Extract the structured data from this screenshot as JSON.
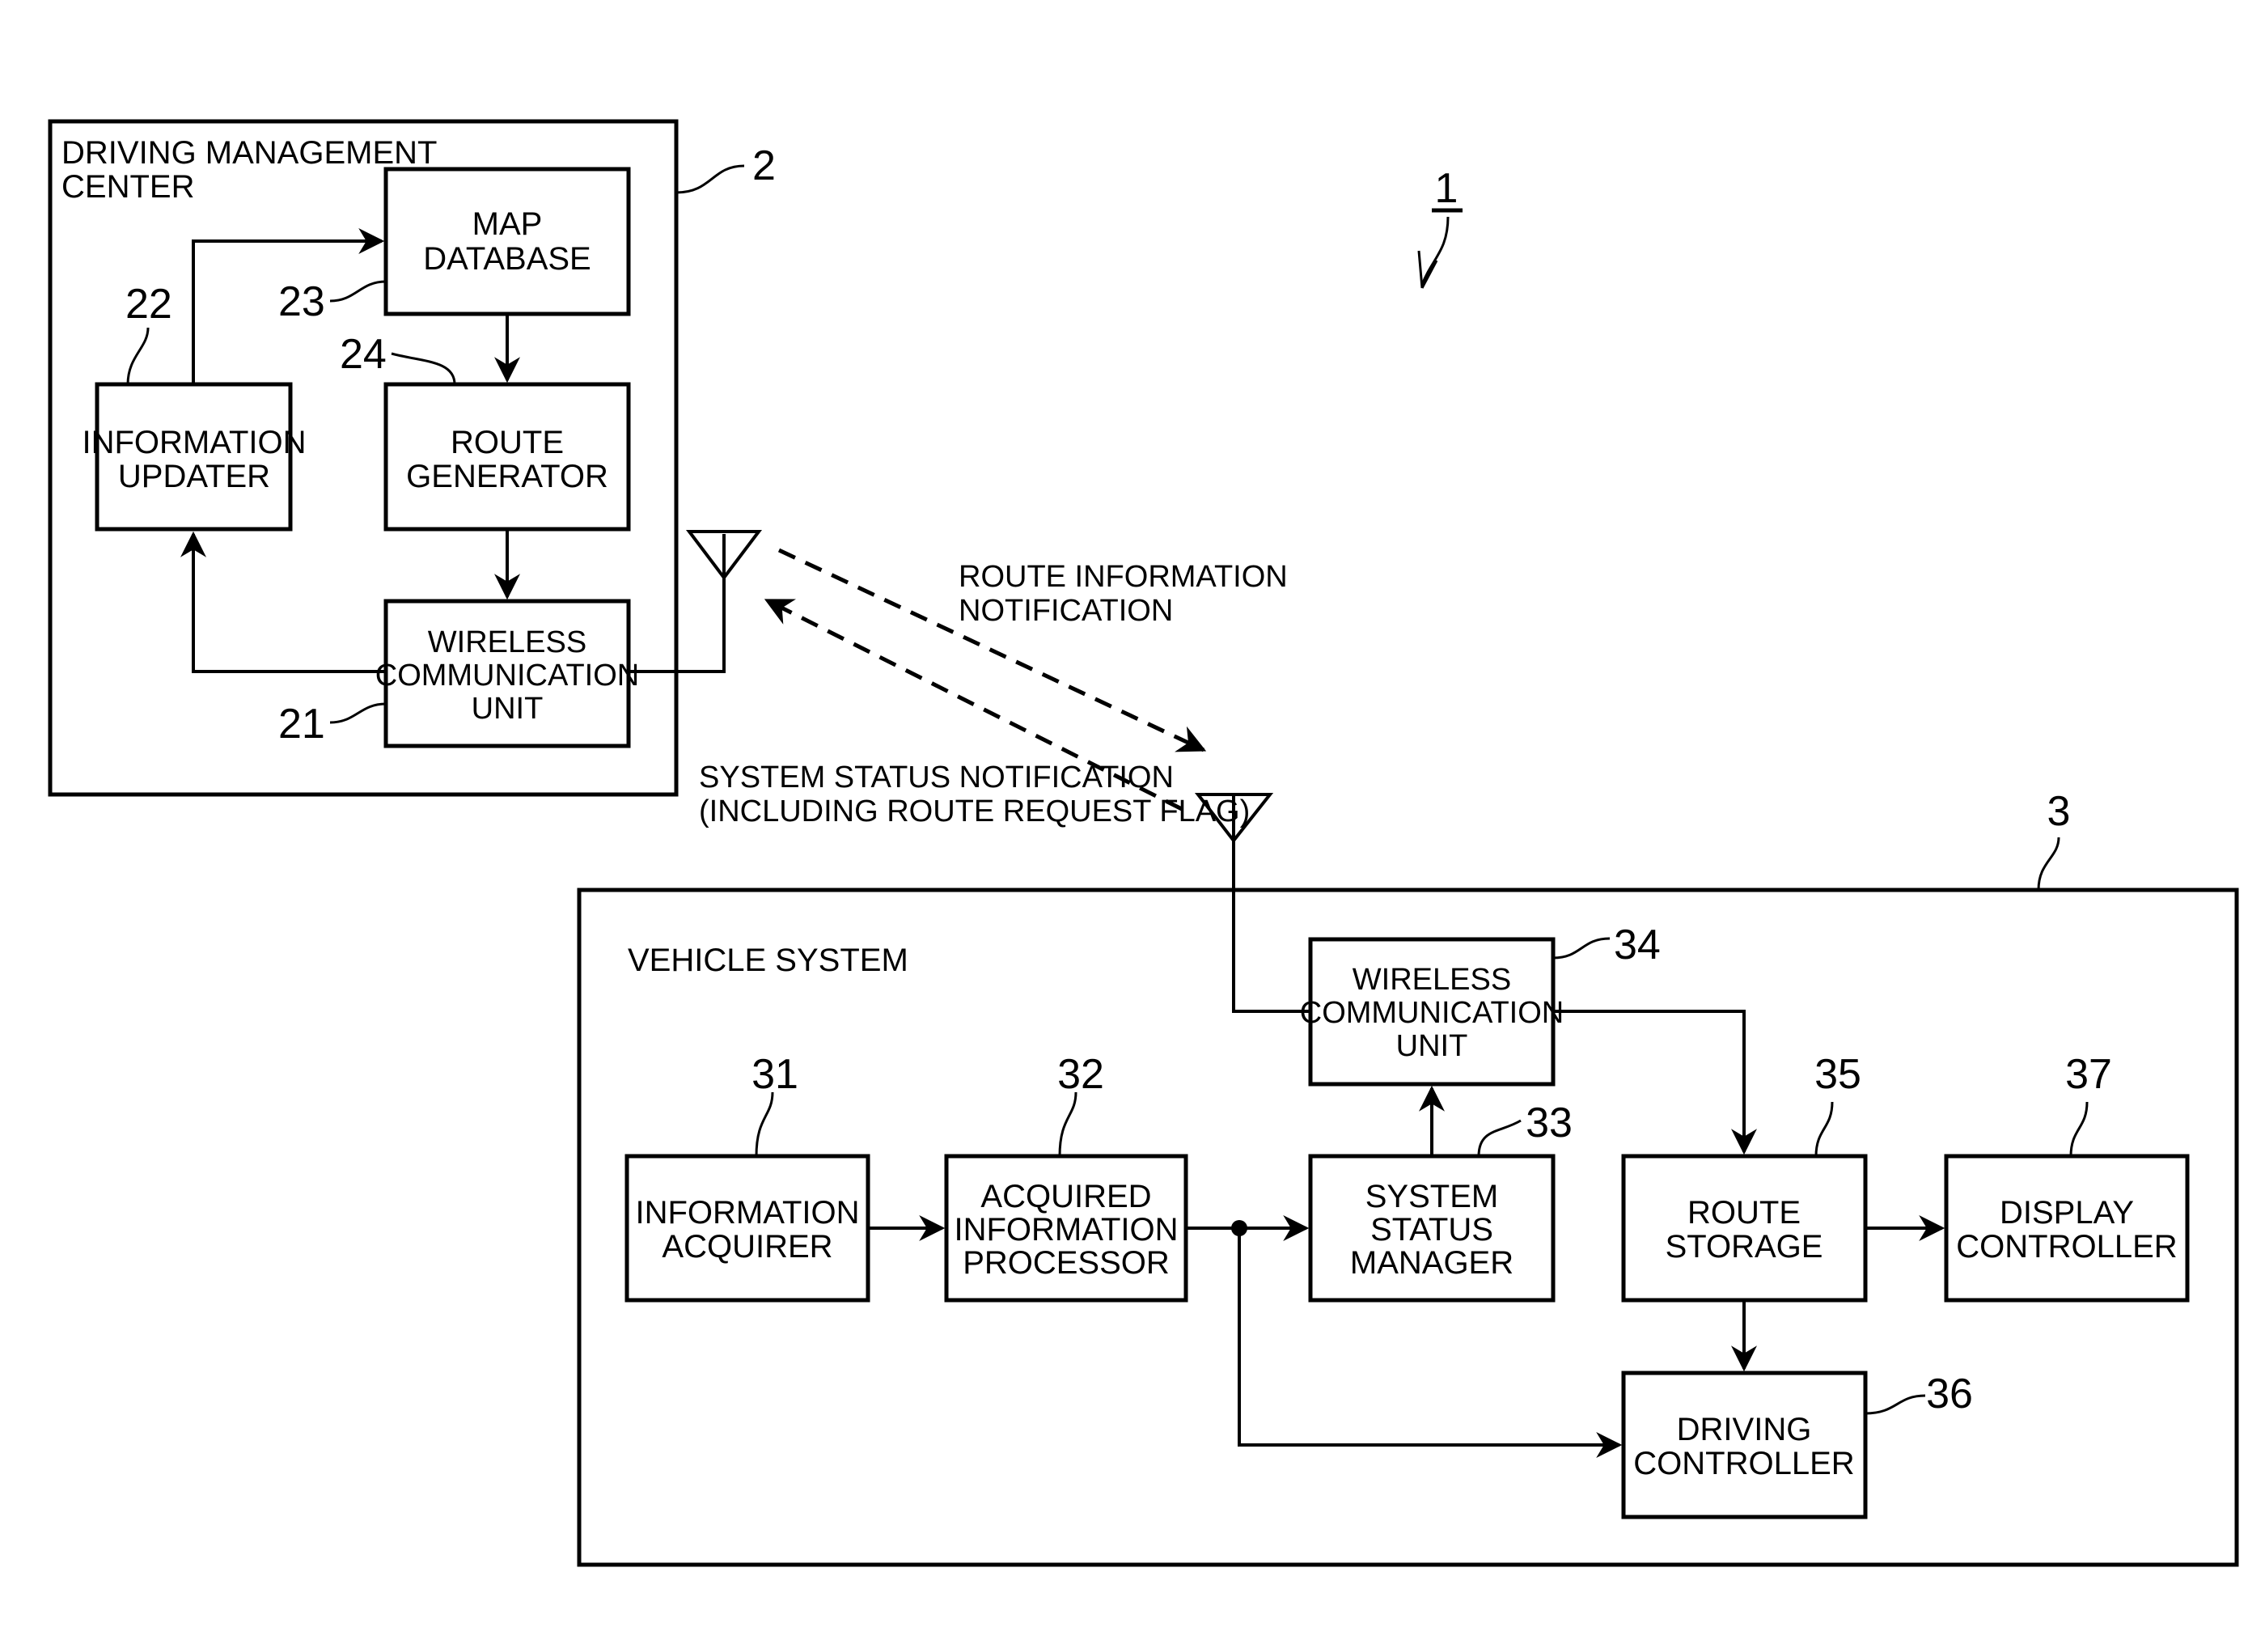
{
  "figure": {
    "ref": "1",
    "center": {
      "ref": "2",
      "title_lines": [
        "DRIVING MANAGEMENT",
        "CENTER"
      ],
      "blocks": {
        "map_database": {
          "ref": "23",
          "lines": [
            "MAP",
            "DATABASE"
          ]
        },
        "information_updater": {
          "ref": "22",
          "lines": [
            "INFORMATION",
            "UPDATER"
          ]
        },
        "route_generator": {
          "ref": "24",
          "lines": [
            "ROUTE",
            "GENERATOR"
          ]
        },
        "wireless_unit": {
          "ref": "21",
          "lines": [
            "WIRELESS",
            "COMMUNICATION",
            "UNIT"
          ]
        }
      }
    },
    "links": {
      "route_info": [
        "ROUTE INFORMATION",
        "NOTIFICATION"
      ],
      "system_status": [
        "SYSTEM STATUS NOTIFICATION",
        "(INCLUDING ROUTE REQUEST FLAG)"
      ]
    },
    "vehicle": {
      "ref": "3",
      "title": "VEHICLE SYSTEM",
      "blocks": {
        "wireless_unit": {
          "ref": "34",
          "lines": [
            "WIRELESS",
            "COMMUNICATION",
            "UNIT"
          ]
        },
        "information_acquirer": {
          "ref": "31",
          "lines": [
            "INFORMATION",
            "ACQUIRER"
          ]
        },
        "acquired_info_processor": {
          "ref": "32",
          "lines": [
            "ACQUIRED",
            "INFORMATION",
            "PROCESSOR"
          ]
        },
        "system_status_manager": {
          "ref": "33",
          "lines": [
            "SYSTEM",
            "STATUS",
            "MANAGER"
          ]
        },
        "route_storage": {
          "ref": "35",
          "lines": [
            "ROUTE",
            "STORAGE"
          ]
        },
        "display_controller": {
          "ref": "37",
          "lines": [
            "DISPLAY",
            "CONTROLLER"
          ]
        },
        "driving_controller": {
          "ref": "36",
          "lines": [
            "DRIVING",
            "CONTROLLER"
          ]
        }
      }
    }
  }
}
